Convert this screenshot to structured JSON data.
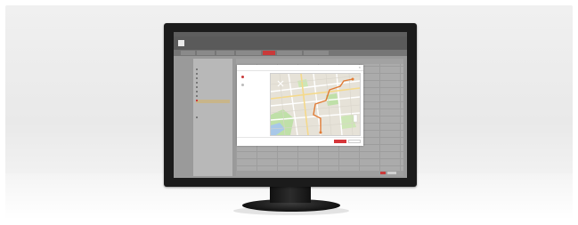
{
  "window": {
    "title": "",
    "app_name": "",
    "subtitle": ""
  },
  "nav": {
    "items": [
      {
        "label": "",
        "active": false
      },
      {
        "label": "",
        "active": false
      },
      {
        "label": "",
        "active": false
      },
      {
        "label": "",
        "active": false
      },
      {
        "label": "",
        "active": true
      },
      {
        "label": "",
        "active": false
      },
      {
        "label": "",
        "active": false
      }
    ]
  },
  "left_panel": {
    "title": "",
    "items": [
      "",
      "",
      "",
      "",
      "",
      "",
      "",
      ""
    ],
    "selected_index": 7,
    "section_title": "",
    "section_items": [
      ""
    ]
  },
  "dialog": {
    "title": "",
    "side_items": [
      {
        "label": "",
        "active": true
      },
      {
        "label": "",
        "active": false
      }
    ],
    "ok_label": "",
    "cancel_label": ""
  },
  "colors": {
    "accent": "#c93a3a",
    "map_route": "#e07b35",
    "map_park": "#bfe0a8",
    "map_water": "#a8c8e8"
  },
  "icons": [
    "close-icon",
    "map-marker-icon"
  ]
}
